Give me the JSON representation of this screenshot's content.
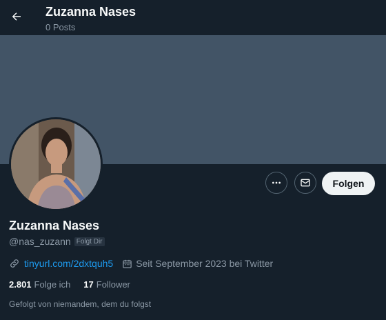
{
  "header": {
    "title": "Zuzanna Nases",
    "posts": "0 Posts",
    "back_icon": "arrow-left-icon"
  },
  "profile": {
    "name": "Zuzanna Nases",
    "handle": "@nas_zuzann",
    "badge": "Folgt Dir",
    "link": "tinyurl.com/2dxtquh5",
    "joined": "Seit September 2023 bei Twitter"
  },
  "actions": {
    "more_icon": "more-icon",
    "mail_icon": "mail-icon",
    "follow_label": "Folgen"
  },
  "stats": {
    "following_count": "2.801",
    "following_label": "Folge ich",
    "followers_count": "17",
    "followers_label": "Follower"
  },
  "followed_by": "Gefolgt von niemandem, dem du folgst",
  "colors": {
    "background": "#15202b",
    "banner": "#425466",
    "link": "#1d9bf0",
    "muted": "#8b98a5"
  }
}
